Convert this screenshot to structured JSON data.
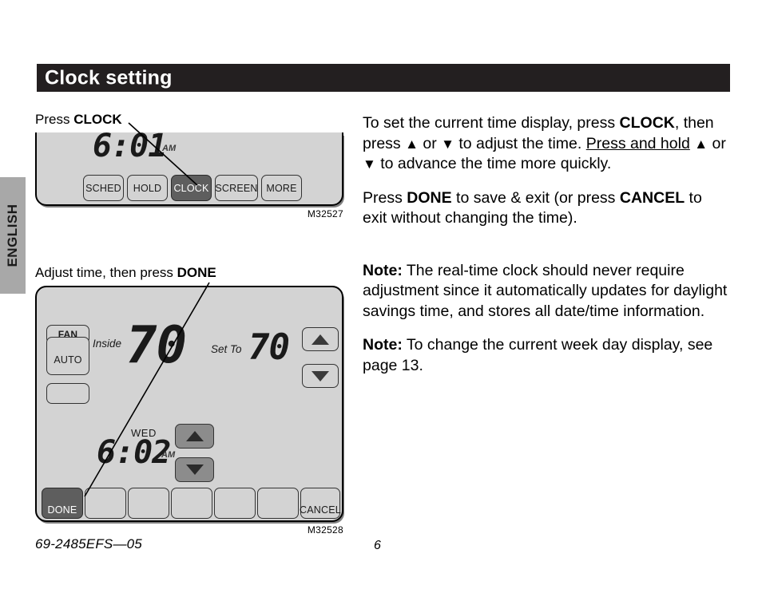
{
  "language_tab": {
    "label": "ENGLISH"
  },
  "header": {
    "title": "Clock setting"
  },
  "figures": [
    {
      "caption_prefix": "Press ",
      "caption_bold": "CLOCK",
      "id_label": "M32527",
      "display": {
        "time": "6:01",
        "ampm": "AM"
      },
      "buttons": [
        {
          "label": "SCHED",
          "state": "normal"
        },
        {
          "label": "HOLD",
          "state": "normal"
        },
        {
          "label": "CLOCK",
          "state": "pressed"
        },
        {
          "label": "SCREEN",
          "state": "normal"
        },
        {
          "label": "MORE",
          "state": "normal"
        }
      ]
    },
    {
      "caption_prefix": "Adjust time, then press ",
      "caption_bold": "DONE",
      "id_label": "M32528",
      "display": {
        "fan_label": "FAN",
        "fan_mode": "AUTO",
        "inside_label": "Inside",
        "inside_temp": "70",
        "setto_label": "Set To",
        "setto_temp": "70",
        "weekday": "WED",
        "time": "6:02",
        "ampm": "AM",
        "up_arrow_icon": "triangle-up",
        "down_arrow_icon": "triangle-down"
      },
      "buttons": [
        {
          "label": "DONE",
          "state": "pressed"
        },
        {
          "label": "",
          "state": "normal"
        },
        {
          "label": "",
          "state": "normal"
        },
        {
          "label": "",
          "state": "normal"
        },
        {
          "label": "",
          "state": "normal"
        },
        {
          "label": "",
          "state": "normal"
        },
        {
          "label": "CANCEL",
          "state": "normal"
        }
      ]
    }
  ],
  "body": {
    "para1": {
      "t1": "To set the current time display, press ",
      "b1": "CLOCK",
      "t2": ", then press ",
      "arrow_up": "▲",
      "t3": " or ",
      "arrow_down": "▼",
      "t4": " to adjust the time. ",
      "u1": "Press and hold",
      "t5": " ",
      "t6": " or ",
      "t7": " to advance the time more quickly."
    },
    "para2": {
      "t1": "Press ",
      "b1": "DONE",
      "t2": " to save & exit (or press ",
      "b2": "CANCEL",
      "t3": " to exit without changing the time)."
    },
    "note1": {
      "label": "Note:",
      "text": " The real-time clock should never require adjustment since it automatically updates for daylight savings time, and stores all date/time information."
    },
    "note2": {
      "label": "Note:",
      "text": " To change the current week day display, see page 13."
    }
  },
  "footer": {
    "doc_number": "69-2485EFS—05",
    "page_number": "6"
  },
  "colors": {
    "header_bar": "#231f20",
    "tab_gray": "#a8a8a8",
    "body_gray": "#d3d3d3",
    "pressed_key": "#5e5e5e",
    "mid_key": "#8c8c8c"
  }
}
